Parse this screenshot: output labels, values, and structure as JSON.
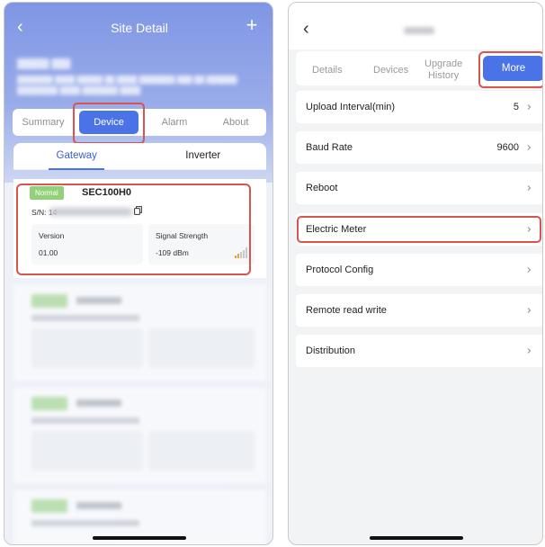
{
  "left": {
    "title": "Site Detail",
    "segments": [
      "Summary",
      "Device",
      "Alarm",
      "About"
    ],
    "subtabs": [
      "Gateway",
      "Inverter"
    ],
    "device": {
      "status": "Normal",
      "name": "SEC100H0",
      "sn_label": "S/N: 14",
      "version_label": "Version",
      "version_value": "01.00",
      "signal_label": "Signal Strength",
      "signal_value": "-109 dBm"
    }
  },
  "right": {
    "tabs": {
      "details": "Details",
      "devices": "Devices",
      "upgrade_1": "Upgrade",
      "upgrade_2": "History",
      "more": "More"
    },
    "settings": [
      {
        "label": "Upload Interval(min)",
        "value": "5"
      },
      {
        "label": "Baud Rate",
        "value": "9600"
      },
      {
        "label": "Reboot",
        "value": ""
      },
      {
        "label": "Electric Meter",
        "value": ""
      },
      {
        "label": "Protocol Config",
        "value": ""
      },
      {
        "label": "Remote read write",
        "value": ""
      },
      {
        "label": "Distribution",
        "value": ""
      }
    ]
  },
  "colors": {
    "accent": "#4a73e8",
    "badge_green": "#93d07a",
    "highlight_red": "#d9534f"
  }
}
